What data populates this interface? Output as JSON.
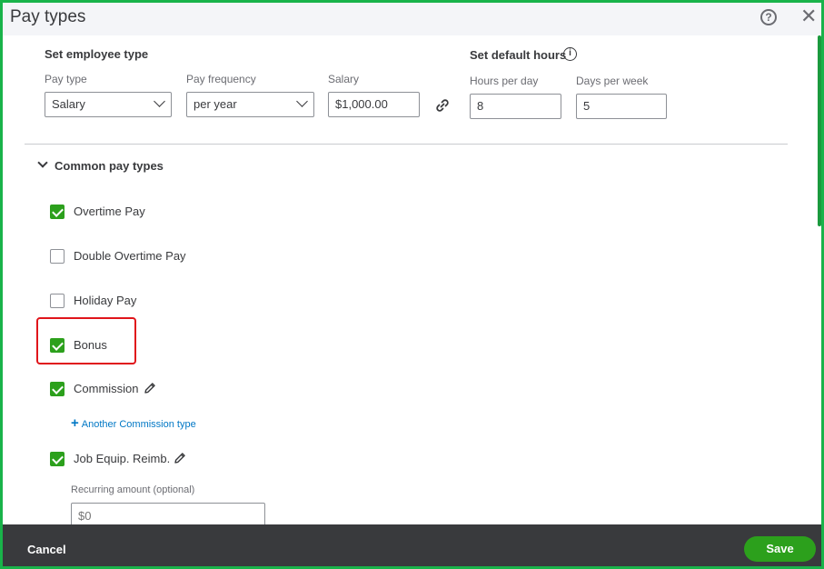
{
  "dialog": {
    "title": "Pay types",
    "help_glyph": "?",
    "close_glyph": "✕"
  },
  "employee_type": {
    "heading": "Set employee type",
    "pay_type_label": "Pay type",
    "pay_type_value": "Salary",
    "pay_frequency_label": "Pay frequency",
    "pay_frequency_value": "per year",
    "salary_label": "Salary",
    "salary_value": "$1,000.00"
  },
  "default_hours": {
    "heading": "Set default hours",
    "info_glyph": "i",
    "hours_per_day_label": "Hours per day",
    "hours_per_day_value": "8",
    "days_per_week_label": "Days per week",
    "days_per_week_value": "5"
  },
  "common_pay_types": {
    "heading": "Common pay types",
    "items": [
      {
        "label": "Overtime Pay",
        "checked": true
      },
      {
        "label": "Double Overtime Pay",
        "checked": false
      },
      {
        "label": "Holiday Pay",
        "checked": false
      },
      {
        "label": "Bonus",
        "checked": true
      },
      {
        "label": "Commission",
        "checked": true
      },
      {
        "label": "Job Equip. Reimb.",
        "checked": true
      }
    ],
    "add_commission_label": "Another Commission type",
    "recurring_amount_label": "Recurring amount (optional)",
    "recurring_amount_placeholder": "$0"
  },
  "footer": {
    "cancel_label": "Cancel",
    "save_label": "Save"
  },
  "colors": {
    "accent_green": "#2ca01c",
    "frame_green": "#19b34a",
    "highlight_red": "#e0151b",
    "link_blue": "#0077c5",
    "footer_bg": "#393a3d"
  },
  "icons": [
    "help-icon",
    "close-icon",
    "info-icon",
    "link-icon",
    "chevron-down-icon",
    "pencil-icon",
    "plus-icon",
    "checkmark-icon"
  ]
}
